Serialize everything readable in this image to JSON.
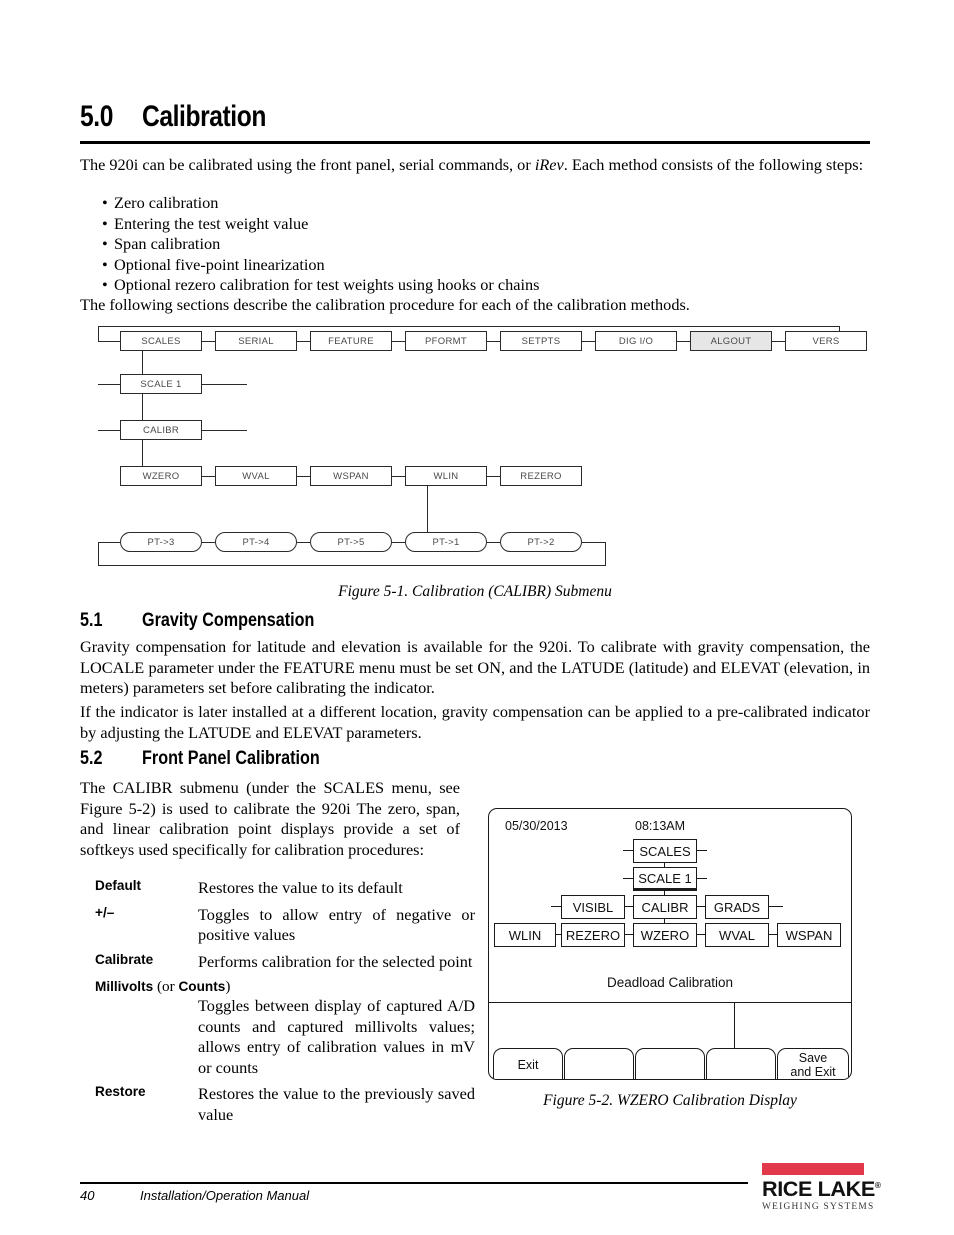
{
  "section": {
    "number": "5.0",
    "title": "Calibration"
  },
  "intro": {
    "p1_before": "The 920i can be calibrated using the front panel, serial commands, or ",
    "p1_italic": "iRev",
    "p1_after": ". Each method consists of the following steps:",
    "bullets": [
      "Zero calibration",
      "Entering the test weight value",
      "Span calibration",
      "Optional five-point linearization",
      "Optional rezero calibration for test weights using hooks or chains"
    ],
    "bullet_marker": "•",
    "p2": "The following sections describe the calibration procedure for each of the calibration methods."
  },
  "figure1": {
    "caption": "Figure 5-1. Calibration (CALIBR) Submenu",
    "row_top": [
      "SCALES",
      "SERIAL",
      "FEATURE",
      "PFORMT",
      "SETPTS",
      "DIG I/O",
      "ALGOUT",
      "VERS"
    ],
    "selected_top": "ALGOUT",
    "row_scale": "SCALE 1",
    "row_calibr": "CALIBR",
    "row_w": [
      "WZERO",
      "WVAL",
      "WSPAN",
      "WLIN",
      "REZERO"
    ],
    "row_pt": [
      "PT->3",
      "PT->4",
      "PT->5",
      "PT->1",
      "PT->2"
    ]
  },
  "section51": {
    "number": "5.1",
    "title": "Gravity Compensation",
    "p1": "Gravity compensation for latitude and elevation is available for the 920i. To calibrate with gravity compensation, the LOCALE parameter under the FEATURE menu must be set ON, and the LATUDE (latitude) and ELEVAT (elevation, in meters) parameters set before calibrating the indicator.",
    "p2": "If the indicator is later installed at a different location, gravity compensation can be applied to a pre-calibrated indicator by adjusting the LATUDE and ELEVAT parameters."
  },
  "section52": {
    "number": "5.2",
    "title": "Front Panel Calibration",
    "p1": "The CALIBR submenu (under the SCALES menu, see Figure 5-2) is used to calibrate the 920i The zero, span, and linear calibration point displays provide a set of softkeys used specifically for calibration procedures:",
    "definitions": [
      {
        "term": "Default",
        "term_suffix": "",
        "desc": "Restores the value to its default",
        "full_width": false
      },
      {
        "term": "+/–",
        "term_suffix": "",
        "desc": "Toggles to allow entry of negative or positive values",
        "full_width": false
      },
      {
        "term": "Calibrate",
        "term_suffix": "",
        "desc": "Performs calibration for the selected point",
        "full_width": false
      },
      {
        "term": "Millivolts",
        "term_suffix": " (or Counts)",
        "desc": "Toggles between display of captured A/D counts and captured millivolts values; allows entry of calibration values in mV or counts",
        "full_width": true
      },
      {
        "term": "Restore",
        "term_suffix": "",
        "desc": "Restores the value to the previously saved value",
        "full_width": false
      }
    ]
  },
  "figure2": {
    "caption": "Figure 5-2. WZERO Calibration Display",
    "date": "05/30/2013",
    "time": "08:13AM",
    "menu_scales": "SCALES",
    "menu_scale1": "SCALE 1",
    "menu_visibl": "VISIBL",
    "menu_calibr": "CALIBR",
    "menu_grads": "GRADS",
    "menu_wlin": "WLIN",
    "menu_rezero": "REZERO",
    "menu_wzero": "WZERO",
    "menu_wval": "WVAL",
    "menu_wspan": "WSPAN",
    "status": "Deadload Calibration",
    "softkeys": [
      "Exit",
      "",
      "",
      "",
      "Save\nand Exit"
    ],
    "softkey_1": "Exit",
    "softkey_5_line1": "Save",
    "softkey_5_line2": "and Exit"
  },
  "footer": {
    "page_number": "40",
    "manual_title": "Installation/Operation Manual",
    "logo_name": "RICE LAKE",
    "logo_trademark": "®",
    "logo_sub": "WEIGHING SYSTEMS",
    "logo_red": "#E2384C"
  }
}
